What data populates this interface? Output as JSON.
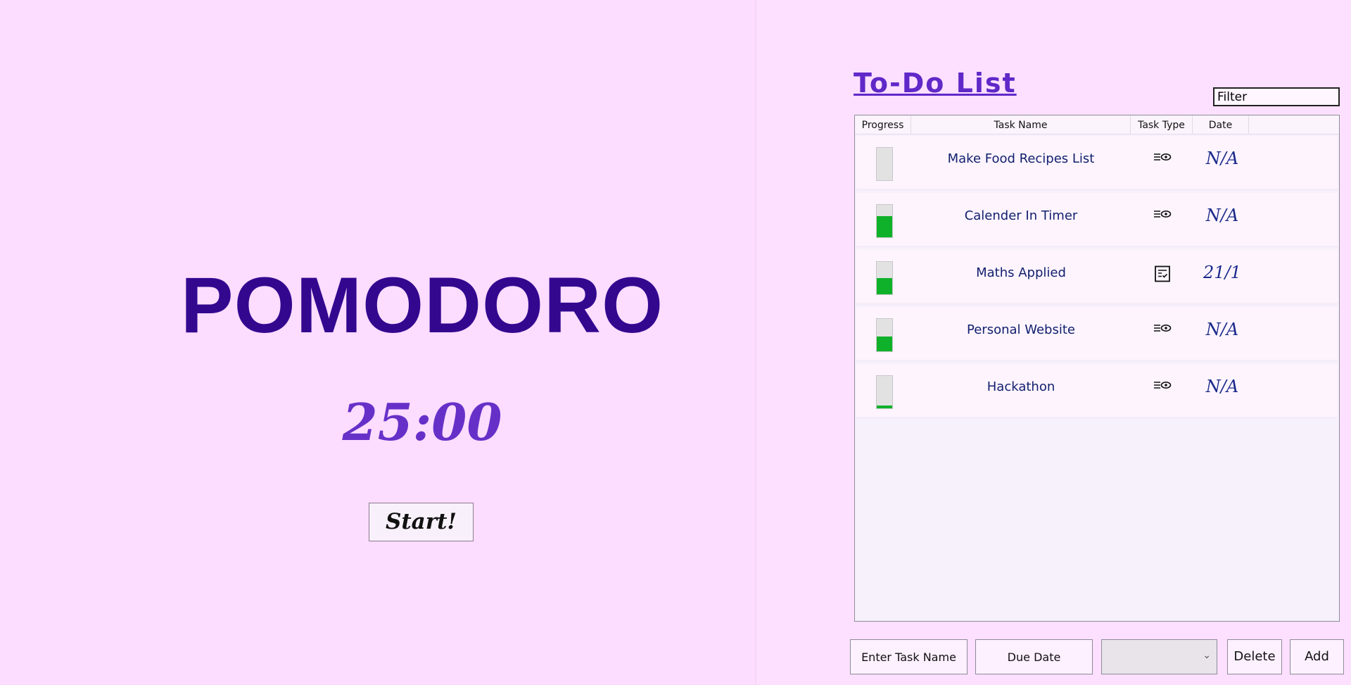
{
  "pomodoro": {
    "title": "POMODORO",
    "timer": "25:00",
    "start_label": "Start!"
  },
  "todo": {
    "title": "To-Do List",
    "filter_placeholder": "Filter",
    "columns": [
      "Progress",
      "Task Name",
      "Task Type",
      "Date"
    ],
    "rows": [
      {
        "name": "Make Food Recipes List",
        "type_icon": "list-view-icon",
        "date": "N/A",
        "progress": 0.0
      },
      {
        "name": "Calender In Timer",
        "type_icon": "list-view-icon",
        "date": "N/A",
        "progress": 0.65
      },
      {
        "name": "Maths Applied",
        "type_icon": "checklist-icon",
        "date": "21/1",
        "progress": 0.5
      },
      {
        "name": "Personal Website",
        "type_icon": "list-view-icon",
        "date": "N/A",
        "progress": 0.45
      },
      {
        "name": "Hackathon",
        "type_icon": "list-view-icon",
        "date": "N/A",
        "progress": 0.08
      }
    ]
  },
  "controls": {
    "task_name_placeholder": "Enter Task Name",
    "due_date_placeholder": "Due Date",
    "task_type_selected": "",
    "delete_label": "Delete",
    "add_label": "Add"
  },
  "colors": {
    "background": "#fcdcff",
    "title": "#33088f",
    "timer": "#6630c8",
    "todo_title": "#6028c8",
    "task_text": "#12206e",
    "progress_fill": "#0fb12a",
    "progress_empty": "#e2e2e2"
  }
}
